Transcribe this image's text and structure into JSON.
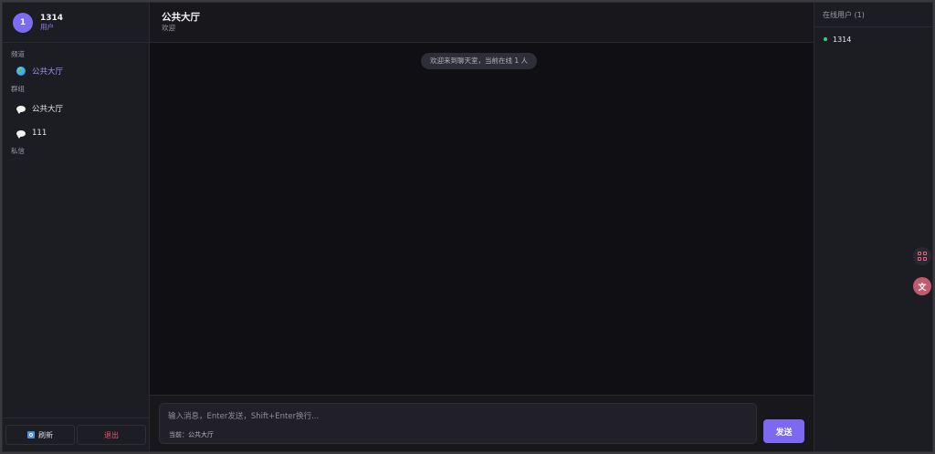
{
  "profile": {
    "avatar_letter": "1",
    "name": "1314",
    "role": "用户"
  },
  "sidebar": {
    "sections": {
      "channels": "频道",
      "groups": "群组",
      "private": "私信"
    },
    "channels": [
      {
        "label": "公共大厅",
        "icon": "globe-icon",
        "active": true
      }
    ],
    "groups": [
      {
        "label": "公共大厅",
        "icon": "chat-bubble-icon"
      },
      {
        "label": "111",
        "icon": "chat-bubble-icon"
      }
    ],
    "footer": {
      "refresh_label": "刷新",
      "logout_label": "退出"
    }
  },
  "chat": {
    "title": "公共大厅",
    "subtitle": "欢迎",
    "system_message": "欢迎来到聊天室，当前在线 1 人",
    "input_placeholder": "输入消息，Enter发送，Shift+Enter换行...",
    "current_room": "当前：公共大厅",
    "send_label": "发送"
  },
  "online": {
    "header": "在线用户 (1)",
    "users": [
      {
        "name": "1314",
        "status": "online"
      }
    ]
  },
  "colors": {
    "accent": "#7d68f2",
    "online": "#2ed57a",
    "logout": "#f2506a"
  }
}
